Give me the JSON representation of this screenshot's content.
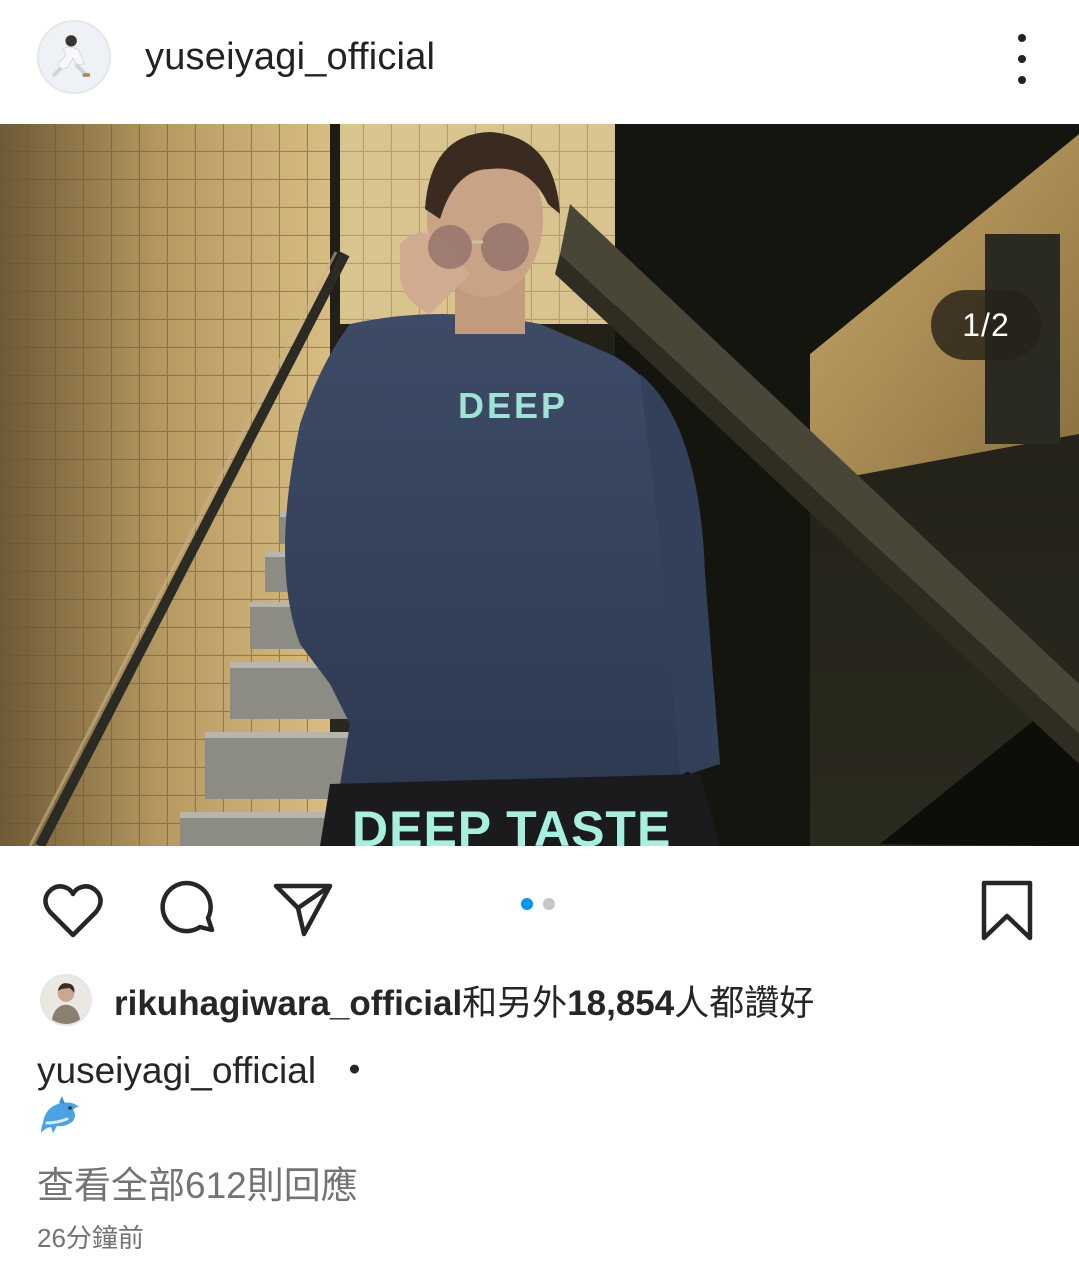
{
  "post": {
    "author": "yuseiyagi_official",
    "image_counter": "1/2",
    "carousel": {
      "count": 2,
      "active_index": 0
    },
    "image_text": {
      "sweater": "DEEP",
      "bottom": "DEEP TASTE"
    },
    "likes": {
      "user": "rikuhagiwara_official",
      "joiner": "和另外",
      "count": "18,854",
      "suffix": "人都讚好"
    },
    "caption": {
      "username": "yuseiyagi_official",
      "separator": "・",
      "emoji": "dolphin"
    },
    "view_comments": "查看全部612則回應",
    "timestamp": "26分鐘前"
  },
  "icons": {
    "more": "more-vertical-icon",
    "like": "heart-icon",
    "comment": "comment-icon",
    "share": "share-icon",
    "save": "bookmark-icon"
  },
  "colors": {
    "text": "#262626",
    "secondary": "#737373",
    "accent": "#0095f6"
  }
}
